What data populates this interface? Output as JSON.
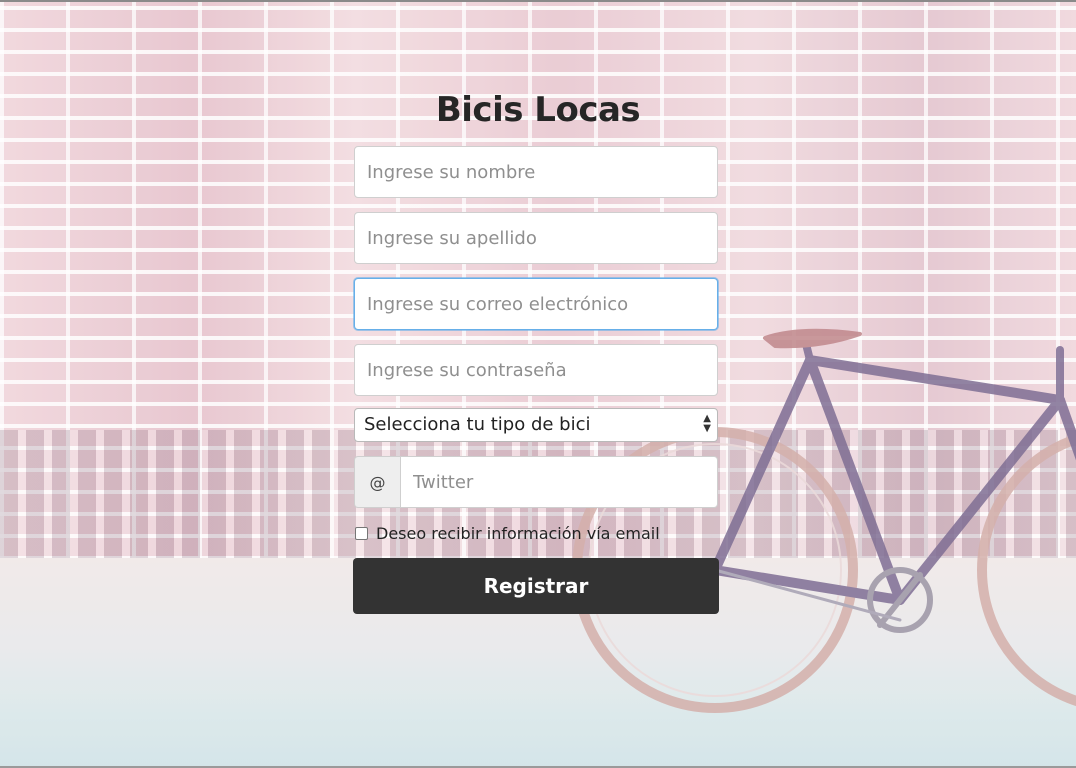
{
  "app": {
    "title": "Bicis Locas"
  },
  "form": {
    "first_name_placeholder": "Ingrese su nombre",
    "last_name_placeholder": "Ingrese su apellido",
    "email_placeholder": "Ingrese su correo electrónico",
    "password_placeholder": "Ingrese su contraseña",
    "bike_type_selected": "Selecciona tu tipo de bici",
    "twitter_addon": "@",
    "twitter_placeholder": "Twitter",
    "newsletter_label": "Deseo recibir información vía email",
    "newsletter_checked": false,
    "submit_label": "Registrar",
    "focused_field": "email"
  },
  "theme": {
    "button_bg": "#333333",
    "focus_border": "#66afe9"
  },
  "icons": {
    "select_arrows": "up-down-chevron-icon",
    "background": "bicycle-illustration"
  }
}
